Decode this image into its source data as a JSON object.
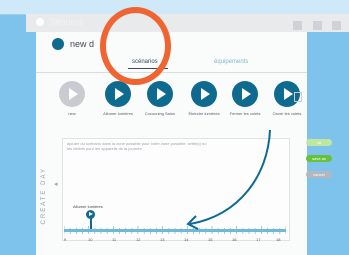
{
  "app": {
    "brand": "TaHoma"
  },
  "modal": {
    "title": "new d"
  },
  "tabs": [
    {
      "label": "scénarios"
    },
    {
      "label": "équipements"
    }
  ],
  "scenarios": [
    {
      "label": "new"
    },
    {
      "label": "Allumer lumières"
    },
    {
      "label": "Cocooning Salon"
    },
    {
      "label": "Éteindre lumières"
    },
    {
      "label": "Fermer les volets"
    },
    {
      "label": "Ouvrir les volets"
    }
  ],
  "info_text": "ajouter du scénario dans la zone possible pour votre zone possible. cette(s) no les définis pour les appareils de la journée",
  "rail_label": "CRÉATE DAY",
  "buttons": [
    {
      "label": "ok"
    },
    {
      "label": "save as"
    },
    {
      "label": "cancel"
    }
  ],
  "event": {
    "label": "Allumer lumières",
    "hour": 10
  },
  "timeline_hours": [
    "9",
    "10",
    "11",
    "12",
    "13",
    "14",
    "15",
    "16",
    "17",
    "18"
  ],
  "colors": {
    "accent": "#0f6a90",
    "annotation": "#f06432",
    "save": "#67c23a"
  }
}
